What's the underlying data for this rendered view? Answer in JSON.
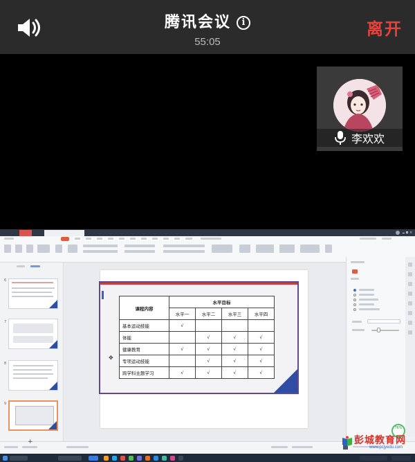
{
  "meeting": {
    "title": "腾讯会议",
    "timer": "55:05",
    "leave_label": "离开"
  },
  "participant": {
    "name": "李欢欢"
  },
  "shared_screen": {
    "slide_table": {
      "header_content": "课程内容",
      "header_goal": "水平目标",
      "levels": [
        "水平一",
        "水平二",
        "水平三",
        "水平四"
      ],
      "check_mark": "√",
      "rows": [
        {
          "label": "基本运动技能",
          "checks": [
            true,
            false,
            false,
            false
          ]
        },
        {
          "label": "体能",
          "checks": [
            false,
            true,
            true,
            true
          ]
        },
        {
          "label": "健康教育",
          "checks": [
            true,
            true,
            true,
            true
          ]
        },
        {
          "label": "专项运动技能",
          "checks": [
            false,
            true,
            true,
            true
          ]
        },
        {
          "label": "跨学科主题学习",
          "checks": [
            true,
            true,
            true,
            true
          ]
        }
      ]
    },
    "thumbnail_numbers": [
      "6",
      "7",
      "8",
      "9"
    ],
    "zoom_badge": "76%"
  },
  "watermark": {
    "title": "彭城教育网",
    "url": "www.pcjyedu.com"
  },
  "colors": {
    "leave": "#e8413c",
    "topbar": "#2b2b2b",
    "slide_accent_blue": "#2f4ea3",
    "slide_border_purple": "#5d4a94"
  },
  "icons": {
    "speaker": "speaker-icon",
    "info": "info-icon",
    "mic": "microphone-icon"
  }
}
